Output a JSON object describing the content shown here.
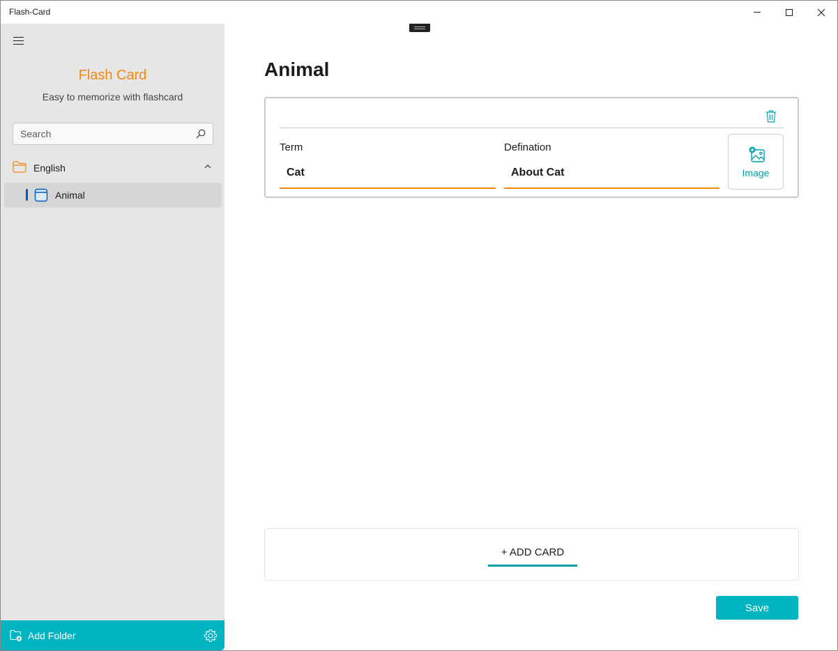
{
  "window": {
    "title": "Flash-Card"
  },
  "sidebar": {
    "brand_title": "Flash Card",
    "brand_subtitle": "Easy to memorize with flashcard",
    "search": {
      "placeholder": "Search",
      "value": ""
    },
    "folders": [
      {
        "label": "English",
        "expanded": true,
        "decks": [
          {
            "label": "Animal",
            "selected": true
          }
        ]
      }
    ],
    "footer": {
      "add_folder_label": "Add Folder"
    }
  },
  "main": {
    "deck_title": "Animal",
    "cards": [
      {
        "term_label": "Term",
        "term_value": "Cat",
        "definition_label": "Defination",
        "definition_value": "About Cat",
        "image_button_label": "Image"
      }
    ],
    "add_card_label": "+ ADD CARD",
    "save_label": "Save"
  },
  "colors": {
    "accent_orange": "#f0870f",
    "accent_teal": "#00b5c1",
    "sidebar_bg": "#e6e6e6",
    "selection_blue": "#005fb8"
  }
}
